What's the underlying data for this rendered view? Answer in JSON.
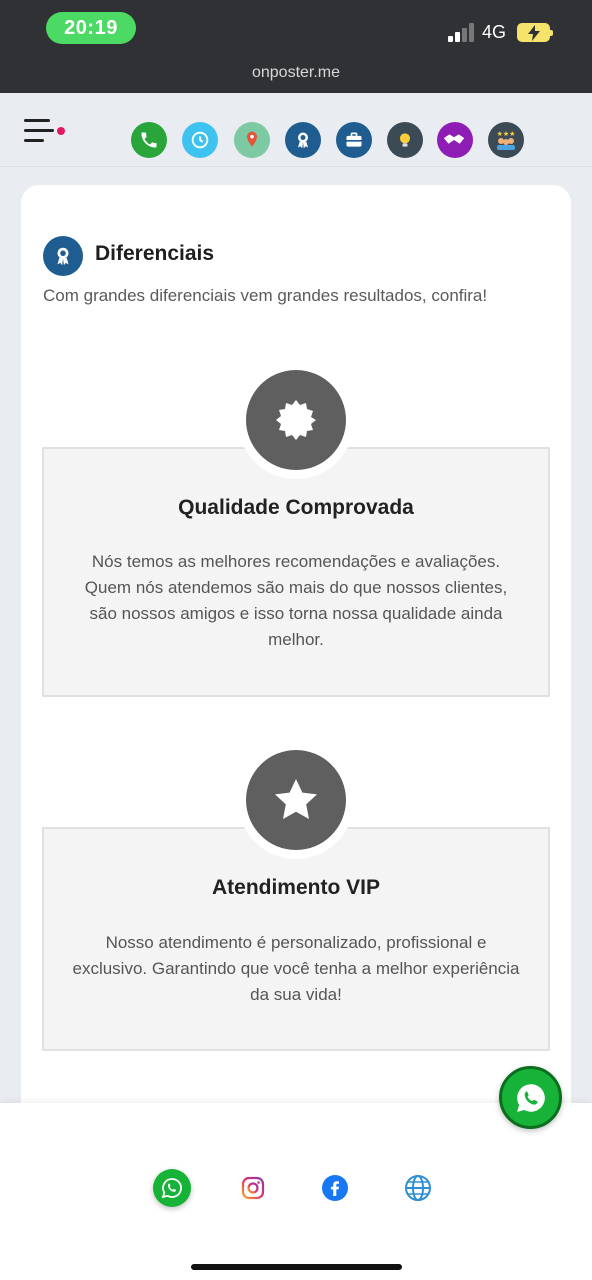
{
  "status_bar": {
    "time": "20:19",
    "network": "4G",
    "battery_color": "#f6e36b"
  },
  "browser": {
    "url": "onposter.me"
  },
  "nav": {
    "icons": [
      {
        "name": "phone-icon",
        "color": "#2aa53b"
      },
      {
        "name": "clock-icon",
        "color": "#3ec3f0"
      },
      {
        "name": "map-pin-icon",
        "color": "#7cc9a3"
      },
      {
        "name": "award-icon",
        "color": "#1f5d91"
      },
      {
        "name": "briefcase-icon",
        "color": "#1f5d91"
      },
      {
        "name": "lightbulb-icon",
        "color": "#3b4a55"
      },
      {
        "name": "handshake-icon",
        "color": "#8e1db3"
      },
      {
        "name": "team-icon",
        "color": "#3b4a55"
      }
    ]
  },
  "section": {
    "title": "Diferenciais",
    "subtitle": "Com grandes diferenciais vem grandes resultados, confira!",
    "icon": "award-icon"
  },
  "features": [
    {
      "icon": "seal-icon",
      "title": "Qualidade Comprovada",
      "description": "Nós temos as melhores recomendações e avaliações. Quem nós atendemos são mais do que nossos clientes, são nossos amigos e isso torna nossa qualidade ainda melhor."
    },
    {
      "icon": "star-icon",
      "title": "Atendimento VIP",
      "description": "Nosso atendimento é personalizado, profissional e exclusivo. Garantindo que você tenha a melhor experiência da sua vida!"
    }
  ],
  "floating_button": {
    "icon": "whatsapp-icon",
    "color": "#16b338"
  },
  "bottom_bar": {
    "icons": [
      "whatsapp-icon",
      "instagram-icon",
      "facebook-icon",
      "globe-icon"
    ]
  }
}
